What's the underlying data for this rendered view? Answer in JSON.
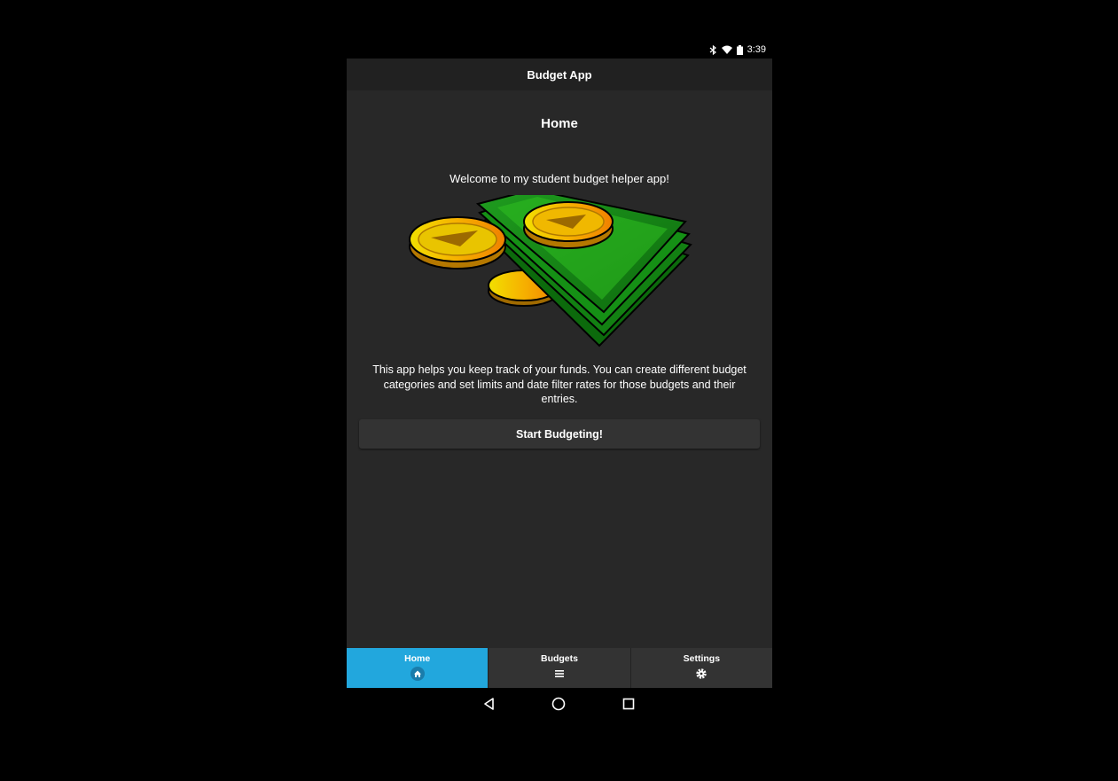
{
  "status_bar": {
    "time": "3:39",
    "icons": [
      "bluetooth-icon",
      "wifi-icon",
      "battery-icon"
    ]
  },
  "app_bar": {
    "title": "Budget App"
  },
  "home": {
    "title": "Home",
    "welcome": "Welcome to my student budget helper app!",
    "description": "This app helps you keep track of your funds. You can create different budget categories and set limits and date filter rates for those budgets and their entries.",
    "start_button": "Start Budgeting!"
  },
  "bottom_nav": {
    "active": "Home",
    "active_color": "#22a7dd",
    "tabs": [
      {
        "label": "Home",
        "icon": "home-icon"
      },
      {
        "label": "Budgets",
        "icon": "list-icon"
      },
      {
        "label": "Settings",
        "icon": "gear-icon"
      }
    ]
  },
  "system_nav": [
    "back-icon",
    "home-circle-icon",
    "recents-icon"
  ]
}
